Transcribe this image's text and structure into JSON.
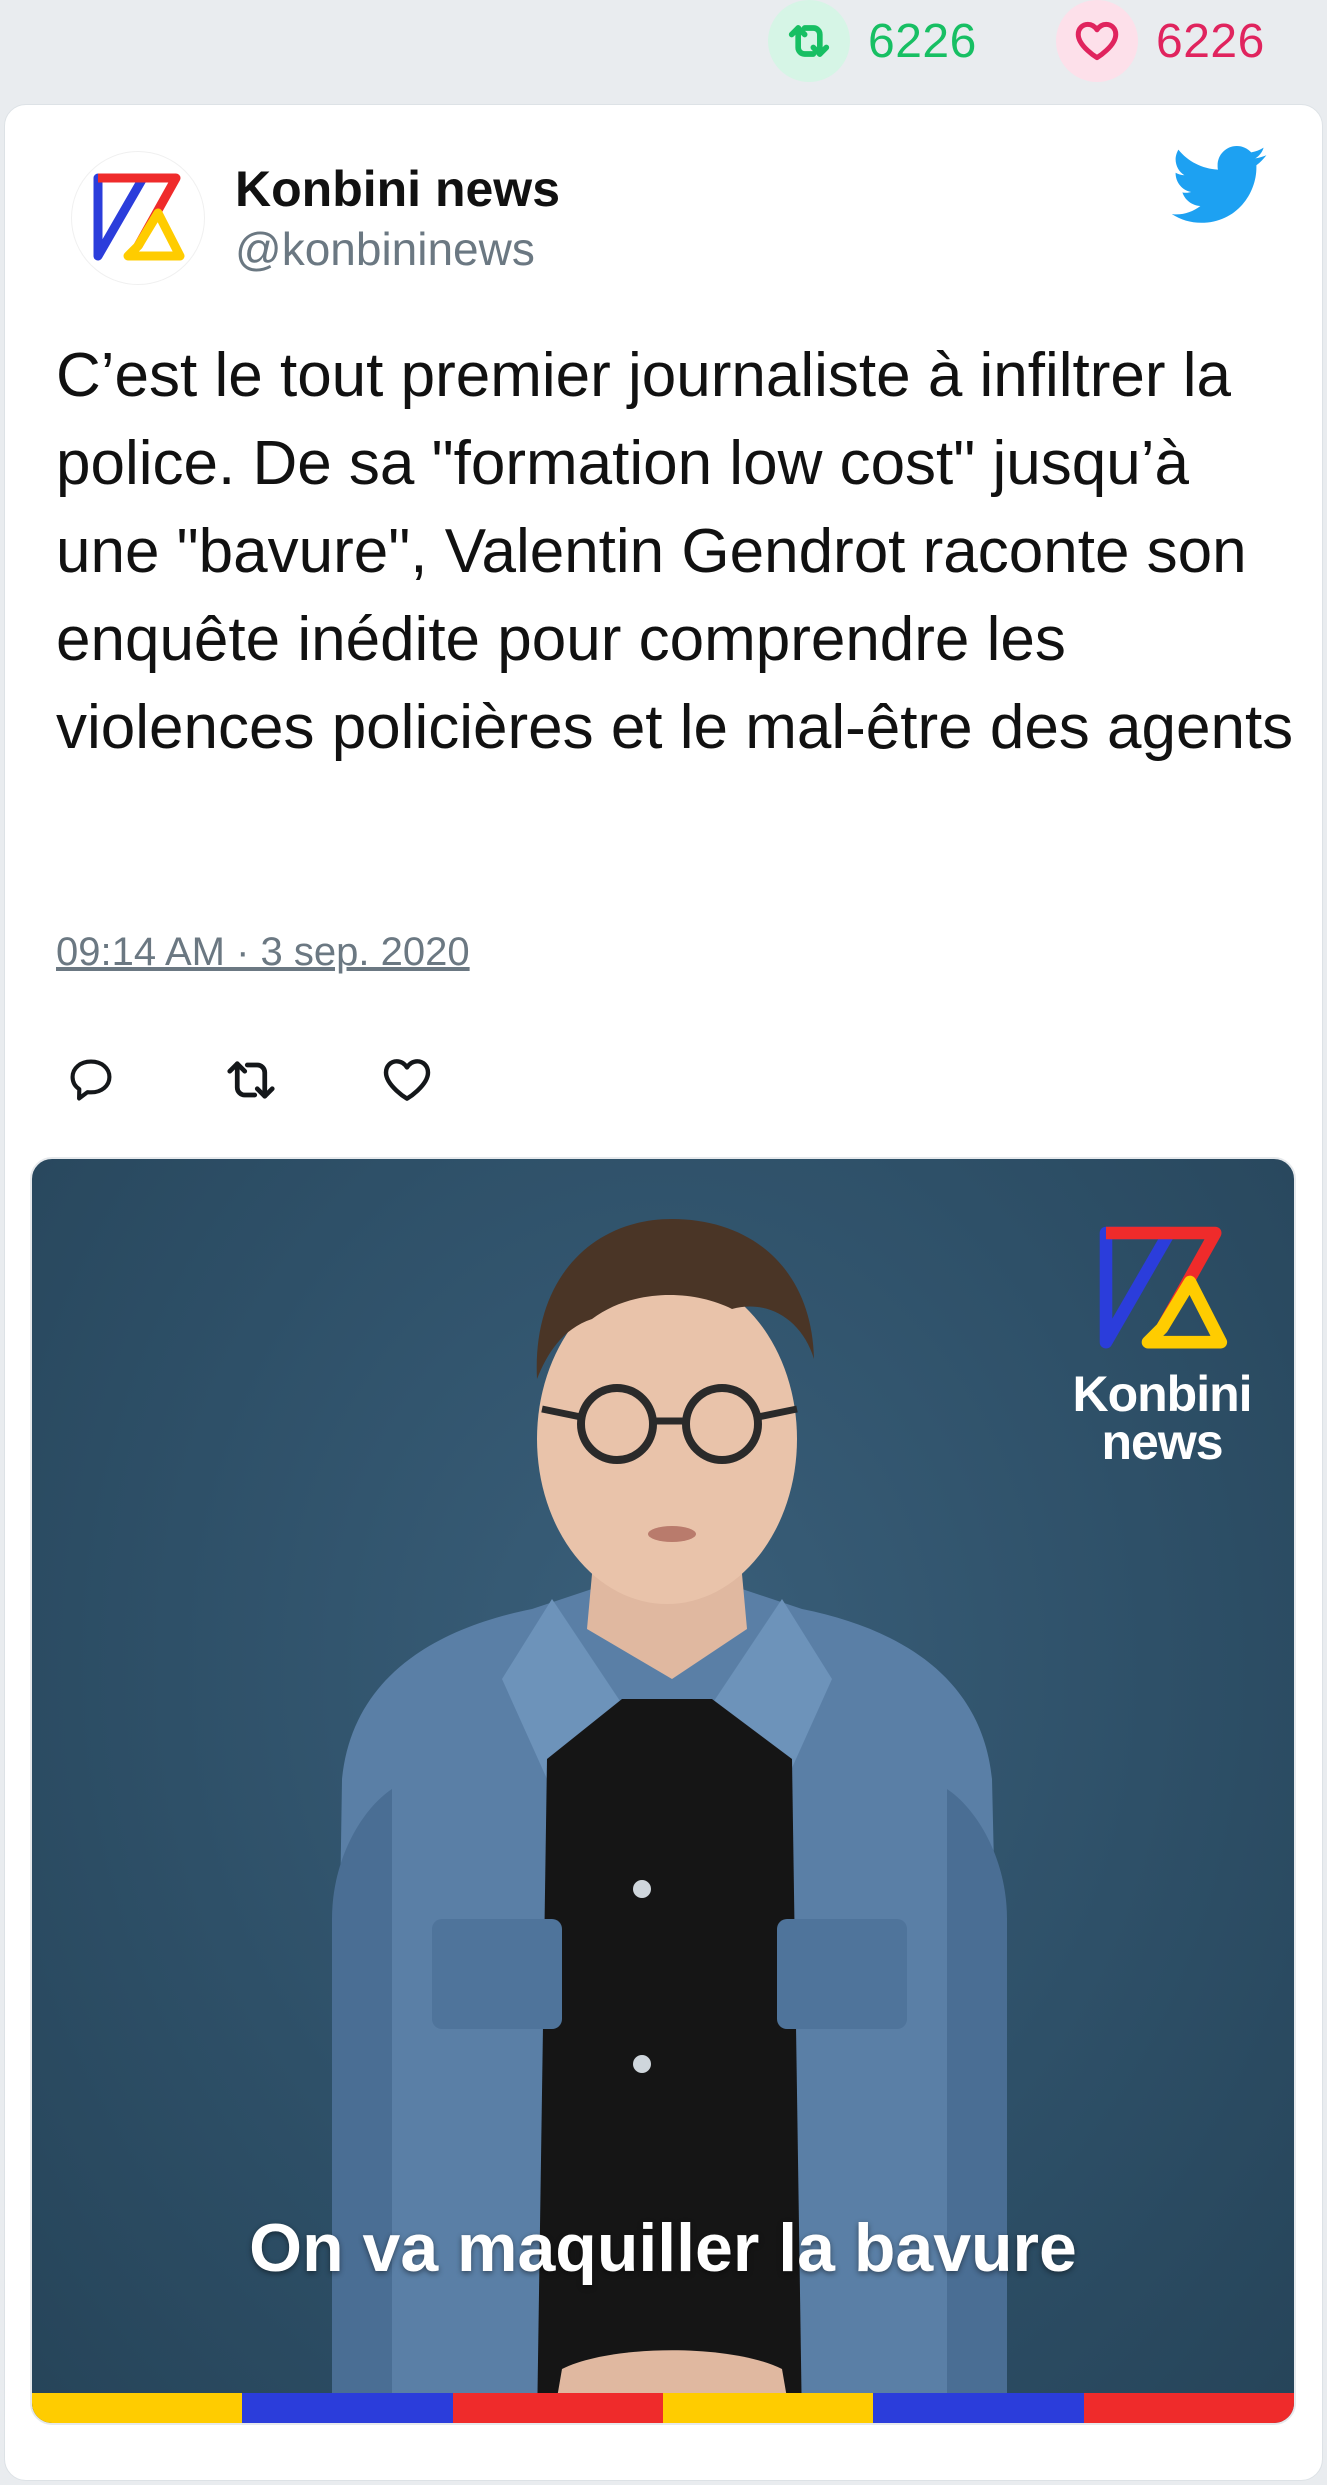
{
  "stats": {
    "retweets": "6226",
    "likes": "6226"
  },
  "author": {
    "name": "Konbini news",
    "handle": "@konbininews"
  },
  "tweet": {
    "text": "C’est le tout premier journaliste à infiltrer la police. De sa \"formation low cost\" jusqu’à une \"bavure\", Valentin Gendrot raconte son enquête inédite pour comprendre les violences policières et le mal-être des agents",
    "timestamp": "09:14 AM · 3 sep. 2020"
  },
  "media": {
    "brand_line1": "Konbini",
    "brand_line2": "news",
    "caption": "On va maquiller la bavure"
  },
  "icons": {
    "retweet": "retweet-icon",
    "like": "heart-icon",
    "reply": "reply-icon",
    "twitter": "twitter-bird-icon",
    "logo": "konbini-logo"
  },
  "colors": {
    "retweet_green": "#17bf63",
    "like_red": "#e0245e",
    "twitter_blue": "#1da1f2",
    "stripe": [
      "#ffcc00",
      "#2b3ddb",
      "#ef2b2b",
      "#ffcc00",
      "#2b3ddb",
      "#ef2b2b"
    ]
  }
}
